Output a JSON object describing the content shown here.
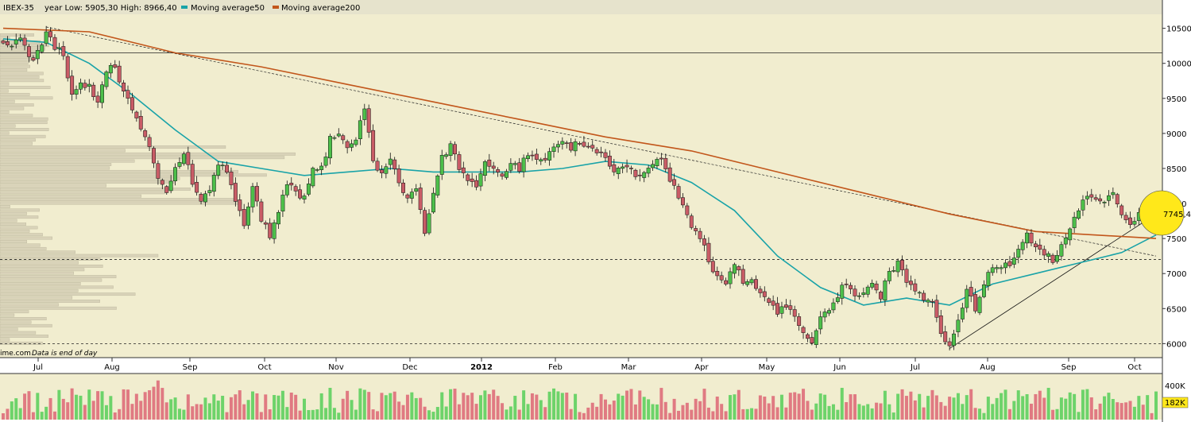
{
  "header": {
    "symbol": "IBEX-35",
    "range_text": "year Low: 5905,30 High: 8966,40",
    "legend": [
      {
        "label": "Moving average50",
        "color": "#19a3a8"
      },
      {
        "label": "Moving average200",
        "color": "#c2561b"
      }
    ]
  },
  "footer": {
    "source": "ime.com",
    "note": "Data is end of day"
  },
  "colors": {
    "background": "#f1edcf",
    "up_candle": "#4dbf4a",
    "down_candle": "#c95c66",
    "ma50": "#19a3a8",
    "ma200": "#c2561b",
    "volume_profile": "#d9d3b9",
    "highlight": "#ffe81a"
  },
  "chart_data": {
    "type": "candlestick",
    "title": "IBEX-35",
    "y_axis": {
      "ticks": [
        6000,
        6500,
        7000,
        7500,
        8000,
        8500,
        9000,
        9500,
        10000,
        10500
      ],
      "range": [
        5800,
        10700
      ],
      "side": "right"
    },
    "x_axis": {
      "labels": [
        "Jul",
        "Aug",
        "Sep",
        "Oct",
        "Nov",
        "Dec",
        "2012",
        "Feb",
        "Mar",
        "Apr",
        "May",
        "Jun",
        "Jul",
        "Aug",
        "Sep",
        "Oct"
      ],
      "bold_labels": [
        "2012"
      ]
    },
    "last_price": "7745,4",
    "year_low": 5905.3,
    "year_high": 8966.4,
    "close_path": [
      [
        0,
        10350
      ],
      [
        2,
        10250
      ],
      [
        4,
        10400
      ],
      [
        6,
        10050
      ],
      [
        8,
        10150
      ],
      [
        10,
        10480
      ],
      [
        12,
        10250
      ],
      [
        14,
        10100
      ],
      [
        16,
        9500
      ],
      [
        18,
        9700
      ],
      [
        20,
        9650
      ],
      [
        22,
        9400
      ],
      [
        24,
        9900
      ],
      [
        26,
        10000
      ],
      [
        28,
        9550
      ],
      [
        30,
        9350
      ],
      [
        32,
        9100
      ],
      [
        34,
        8800
      ],
      [
        36,
        8300
      ],
      [
        38,
        8200
      ],
      [
        40,
        8500
      ],
      [
        42,
        8750
      ],
      [
        44,
        8300
      ],
      [
        46,
        8050
      ],
      [
        48,
        8200
      ],
      [
        50,
        8550
      ],
      [
        52,
        8500
      ],
      [
        54,
        8000
      ],
      [
        56,
        7700
      ],
      [
        58,
        8200
      ],
      [
        60,
        7800
      ],
      [
        62,
        7550
      ],
      [
        64,
        7850
      ],
      [
        66,
        8300
      ],
      [
        68,
        8150
      ],
      [
        70,
        8100
      ],
      [
        72,
        8550
      ],
      [
        74,
        8500
      ],
      [
        76,
        8900
      ],
      [
        78,
        9050
      ],
      [
        80,
        8750
      ],
      [
        82,
        8950
      ],
      [
        84,
        9300
      ],
      [
        86,
        8650
      ],
      [
        88,
        8400
      ],
      [
        90,
        8600
      ],
      [
        92,
        8300
      ],
      [
        94,
        8050
      ],
      [
        96,
        8200
      ],
      [
        98,
        7600
      ],
      [
        100,
        8200
      ],
      [
        102,
        8650
      ],
      [
        104,
        8800
      ],
      [
        106,
        8500
      ],
      [
        108,
        8300
      ],
      [
        110,
        8250
      ],
      [
        112,
        8550
      ],
      [
        114,
        8450
      ],
      [
        116,
        8400
      ],
      [
        118,
        8600
      ],
      [
        120,
        8500
      ],
      [
        122,
        8700
      ],
      [
        124,
        8600
      ],
      [
        126,
        8650
      ],
      [
        128,
        8750
      ],
      [
        130,
        8850
      ],
      [
        132,
        8800
      ],
      [
        134,
        8900
      ],
      [
        136,
        8850
      ],
      [
        138,
        8750
      ],
      [
        140,
        8650
      ],
      [
        142,
        8450
      ],
      [
        144,
        8500
      ],
      [
        146,
        8450
      ],
      [
        148,
        8350
      ],
      [
        150,
        8500
      ],
      [
        152,
        8650
      ],
      [
        154,
        8500
      ],
      [
        156,
        8250
      ],
      [
        158,
        8000
      ],
      [
        160,
        7700
      ],
      [
        162,
        7500
      ],
      [
        164,
        7200
      ],
      [
        166,
        6950
      ],
      [
        168,
        6900
      ],
      [
        170,
        7100
      ],
      [
        172,
        6900
      ],
      [
        174,
        6950
      ],
      [
        176,
        6700
      ],
      [
        178,
        6600
      ],
      [
        180,
        6450
      ],
      [
        182,
        6550
      ],
      [
        184,
        6350
      ],
      [
        186,
        6100
      ],
      [
        188,
        6050
      ],
      [
        190,
        6350
      ],
      [
        192,
        6500
      ],
      [
        194,
        6700
      ],
      [
        196,
        6850
      ],
      [
        198,
        6650
      ],
      [
        200,
        6750
      ],
      [
        202,
        6900
      ],
      [
        204,
        6650
      ],
      [
        206,
        7050
      ],
      [
        208,
        7150
      ],
      [
        210,
        6850
      ],
      [
        212,
        6750
      ],
      [
        214,
        6650
      ],
      [
        216,
        6550
      ],
      [
        218,
        6150
      ],
      [
        220,
        5950
      ],
      [
        222,
        6300
      ],
      [
        224,
        6750
      ],
      [
        226,
        6500
      ],
      [
        228,
        6900
      ],
      [
        230,
        7100
      ],
      [
        232,
        7050
      ],
      [
        234,
        7150
      ],
      [
        236,
        7300
      ],
      [
        238,
        7550
      ],
      [
        240,
        7350
      ],
      [
        242,
        7250
      ],
      [
        244,
        7200
      ],
      [
        246,
        7400
      ],
      [
        248,
        7600
      ],
      [
        250,
        7950
      ],
      [
        252,
        8050
      ],
      [
        254,
        8100
      ],
      [
        256,
        8000
      ],
      [
        258,
        8150
      ],
      [
        260,
        7850
      ],
      [
        262,
        7700
      ],
      [
        264,
        7850
      ],
      [
        266,
        7900
      ],
      [
        268,
        7745
      ]
    ],
    "series": [
      {
        "name": "Moving average50",
        "values": [
          [
            0,
            10350
          ],
          [
            10,
            10300
          ],
          [
            20,
            10000
          ],
          [
            30,
            9550
          ],
          [
            40,
            9050
          ],
          [
            50,
            8600
          ],
          [
            60,
            8500
          ],
          [
            70,
            8400
          ],
          [
            80,
            8450
          ],
          [
            90,
            8500
          ],
          [
            100,
            8450
          ],
          [
            110,
            8450
          ],
          [
            120,
            8450
          ],
          [
            130,
            8500
          ],
          [
            140,
            8600
          ],
          [
            150,
            8550
          ],
          [
            160,
            8300
          ],
          [
            170,
            7900
          ],
          [
            180,
            7250
          ],
          [
            190,
            6800
          ],
          [
            200,
            6550
          ],
          [
            210,
            6650
          ],
          [
            220,
            6550
          ],
          [
            230,
            6850
          ],
          [
            240,
            7000
          ],
          [
            250,
            7150
          ],
          [
            260,
            7300
          ],
          [
            268,
            7550
          ]
        ]
      },
      {
        "name": "Moving average200",
        "values": [
          [
            0,
            10500
          ],
          [
            20,
            10450
          ],
          [
            40,
            10150
          ],
          [
            60,
            9950
          ],
          [
            80,
            9700
          ],
          [
            100,
            9450
          ],
          [
            120,
            9200
          ],
          [
            140,
            8950
          ],
          [
            160,
            8750
          ],
          [
            180,
            8450
          ],
          [
            200,
            8150
          ],
          [
            220,
            7850
          ],
          [
            240,
            7600
          ],
          [
            268,
            7500
          ]
        ]
      }
    ],
    "reference_lines": [
      10150,
      7200,
      6000
    ],
    "volume": {
      "ticks": [
        "400K",
        "182K"
      ],
      "last": "182K"
    }
  }
}
